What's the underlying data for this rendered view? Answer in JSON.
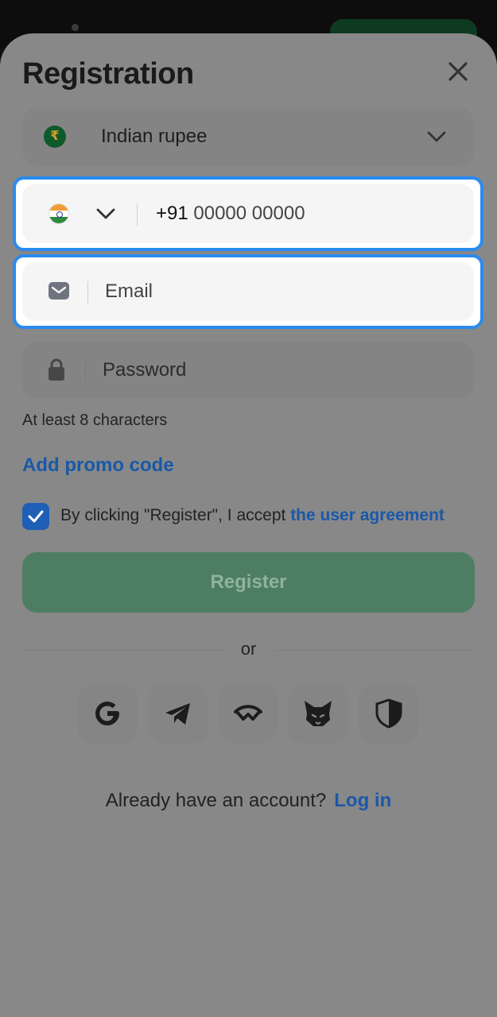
{
  "sheet": {
    "title": "Registration"
  },
  "currency": {
    "symbol": "₹",
    "label": "Indian rupee"
  },
  "phone": {
    "code": "+91",
    "placeholder": "00000 00000"
  },
  "email": {
    "placeholder": "Email"
  },
  "password": {
    "placeholder": "Password",
    "hint": "At least 8 characters"
  },
  "promo": {
    "label": "Add promo code"
  },
  "agreement": {
    "checked": true,
    "prefix": "By clicking \"Register\", I accept ",
    "link": "the user agreement"
  },
  "register": {
    "label": "Register"
  },
  "divider": {
    "label": "or"
  },
  "social": {
    "icons": [
      "google-icon",
      "telegram-icon",
      "walletconnect-icon",
      "metamask-icon",
      "shield-icon"
    ]
  },
  "footer": {
    "question": "Already have an account?",
    "login": "Log in"
  },
  "colors": {
    "highlight": "#2a8bf0",
    "link": "#1a58a8",
    "register_bg": "#4e7e62",
    "checkbox": "#1f5fb6"
  }
}
